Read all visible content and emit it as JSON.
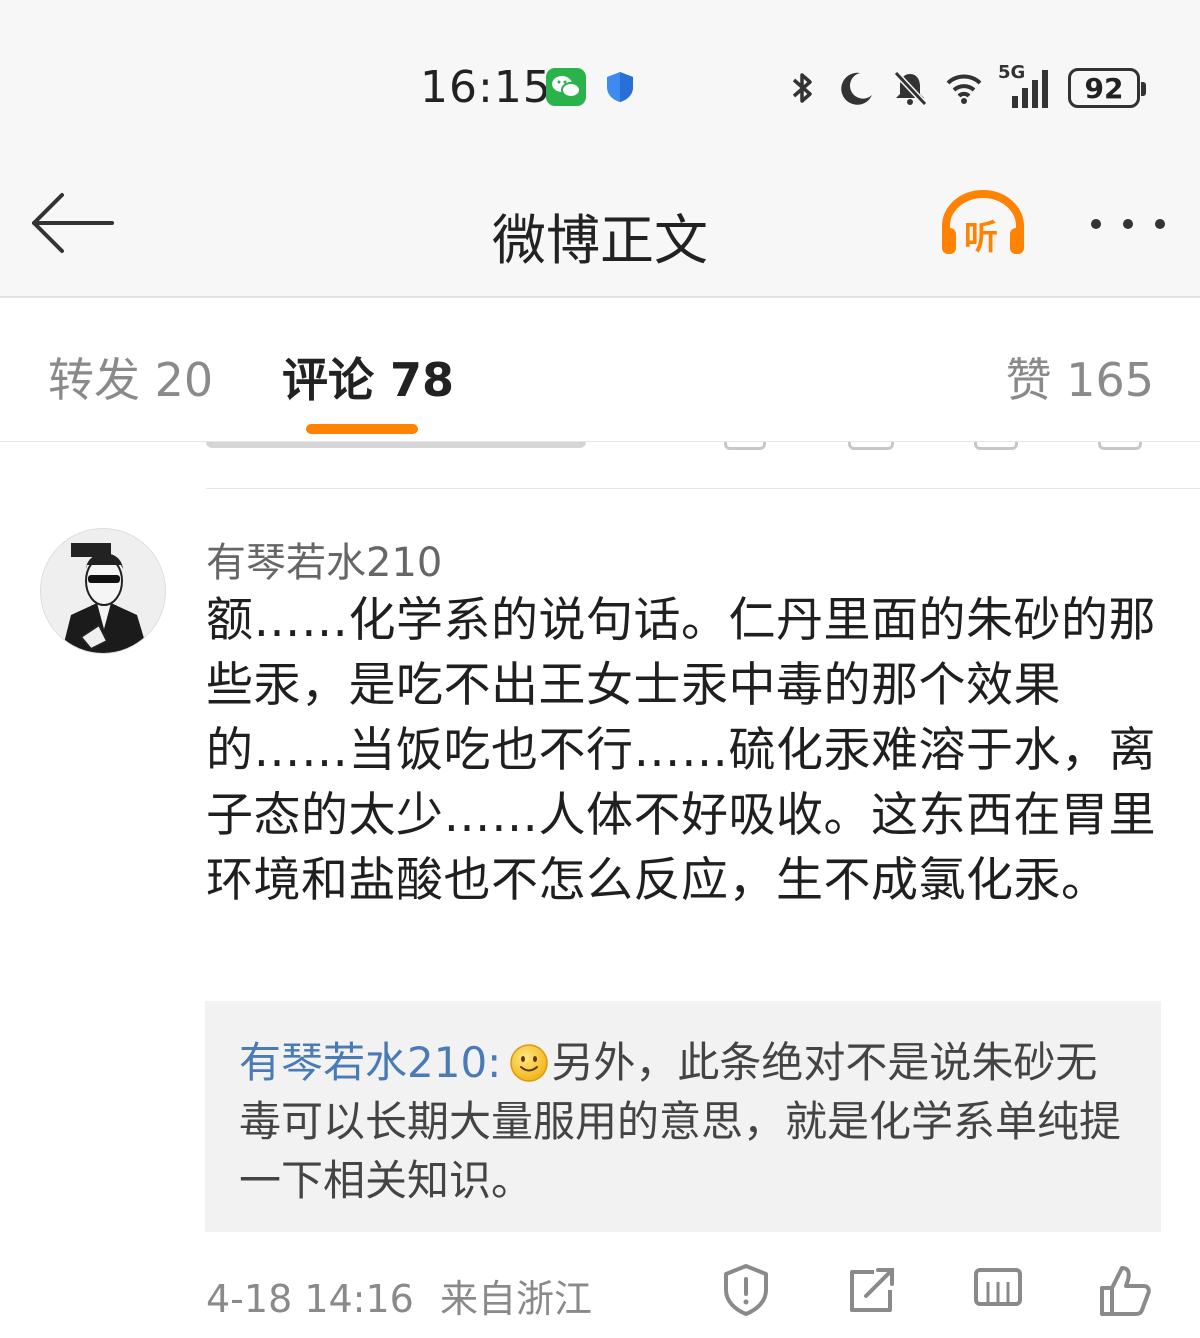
{
  "status_bar": {
    "time": "16:15",
    "network": "5G",
    "battery": "92",
    "icons": [
      "wechat-icon",
      "shield-icon",
      "bluetooth-icon",
      "moon-icon",
      "mute-bell-icon",
      "wifi-icon",
      "signal-icon",
      "battery-icon"
    ]
  },
  "nav": {
    "title": "微博正文",
    "listen_label": "听",
    "icons": [
      "back-arrow-icon",
      "listen-headphone-icon",
      "more-dots-icon"
    ]
  },
  "tabs": {
    "repost": "转发 20",
    "comments": "评论 78",
    "likes": "赞 165",
    "active": "comments"
  },
  "comment": {
    "username": "有琴若水210",
    "text": "额……化学系的说句话。仁丹里面的朱砂的那些汞，是吃不出王女士汞中毒的那个效果的……当饭吃也不行……硫化汞难溶于水，离子态的太少……人体不好吸收。这东西在胃里环境和盐酸也不怎么反应，生不成氯化汞。",
    "reply": {
      "username": "有琴若水210:",
      "text": "另外，此条绝对不是说朱砂无毒可以长期大量服用的意思，就是化学系单纯提一下相关知识。"
    },
    "date": "4-18 14:16",
    "location": "来自浙江",
    "actions": [
      "report-icon",
      "share-icon",
      "comment-icon",
      "like-icon"
    ]
  },
  "colors": {
    "accent": "#ff8200",
    "link": "#4a7bb7",
    "wechat": "#2ab34b"
  }
}
